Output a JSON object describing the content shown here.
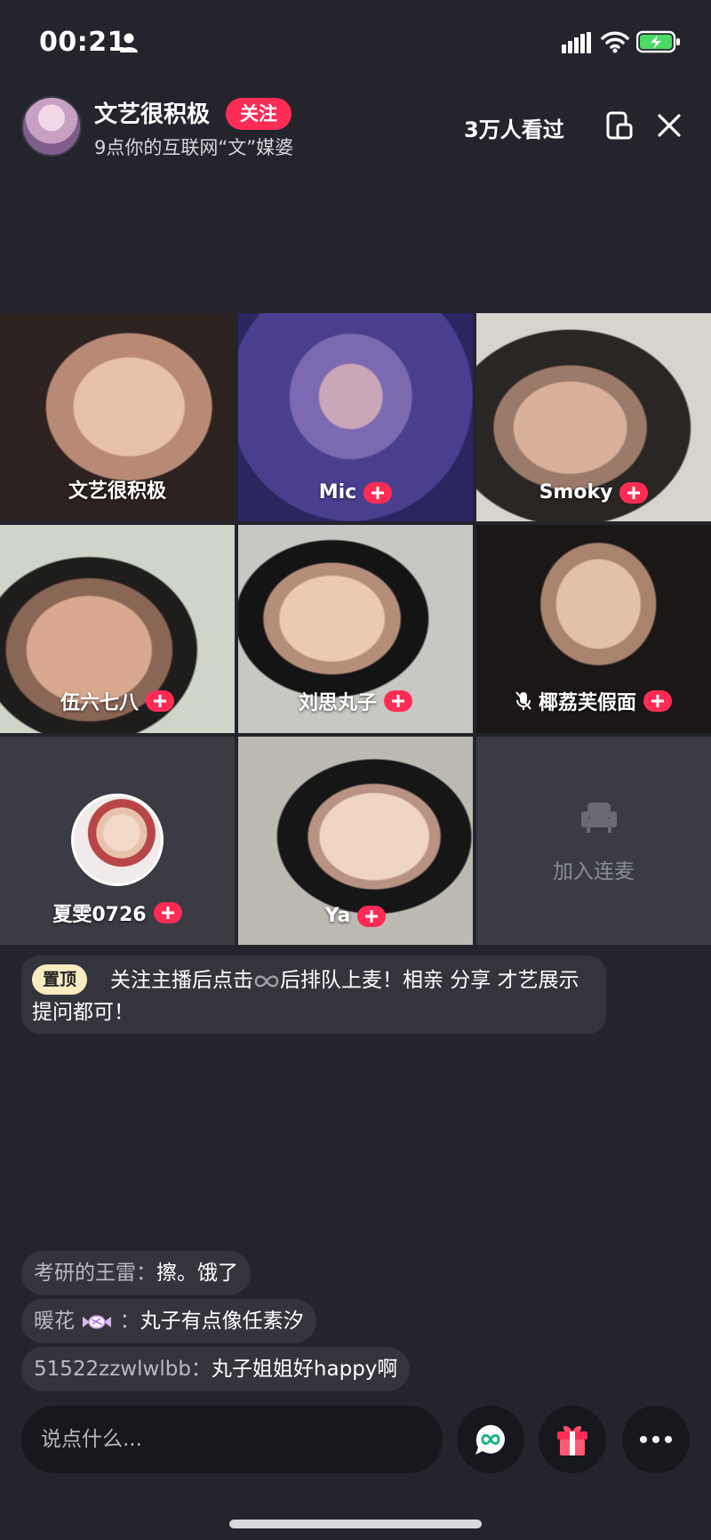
{
  "status": {
    "time": "00:21"
  },
  "header": {
    "host_name": "文艺很积极",
    "follow_label": "关注",
    "host_subtitle": "9点你的互联网“文”媒婆",
    "viewers": "3万人看过"
  },
  "grid": {
    "tiles": [
      {
        "name": "文艺很积极"
      },
      {
        "name": "Mic"
      },
      {
        "name": "Smoky"
      },
      {
        "name": "伍六七八"
      },
      {
        "name": "刘思丸子"
      },
      {
        "name": "椰荔芙假面"
      },
      {
        "name": "夏雯0726"
      },
      {
        "name": "Ya"
      },
      {
        "name": "加入连麦"
      }
    ]
  },
  "pinned": {
    "badge": "置顶",
    "text_before": "关注主播后点击",
    "text_after": "后排队上麦！相亲 分享 才艺展示 提问都可！"
  },
  "chat": [
    {
      "user": "考研的王雷：",
      "message": "擦。饿了"
    },
    {
      "user": "暖花",
      "message": "丸子有点像任素汐"
    },
    {
      "user": "51522zzwlwlbb：",
      "message": "丸子姐姐好happy啊"
    }
  ],
  "bottom_bar": {
    "input_placeholder": "说点什么..."
  },
  "colors": {
    "background": "#24252c",
    "accent": "#fe2c55",
    "pin_badge": "#f8ecc2"
  },
  "icons": [
    "person-icon",
    "signal-icon",
    "wifi-icon",
    "battery-icon",
    "pip-icon",
    "close-icon",
    "plus-icon",
    "mic-off-icon",
    "seat-icon",
    "link-icon",
    "gift-icon",
    "more-icon"
  ]
}
